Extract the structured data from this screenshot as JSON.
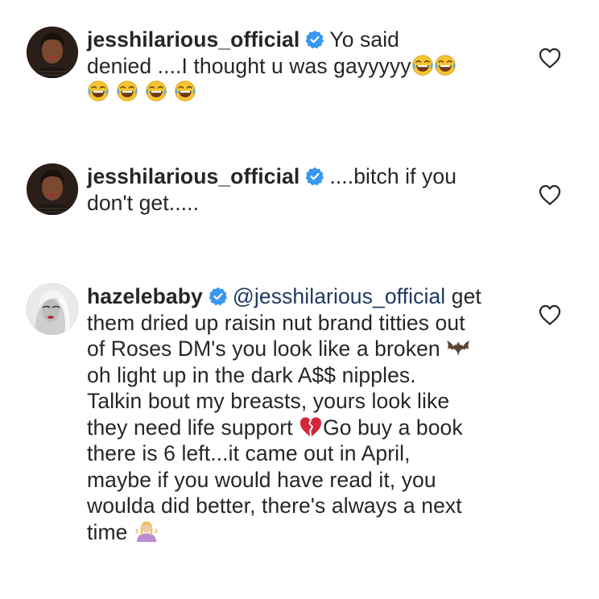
{
  "comments": [
    {
      "username": "jesshilarious_official",
      "line1": "Yo said",
      "line2": "denied ....I thought u was gayyyyy",
      "verified": true
    },
    {
      "username": "jesshilarious_official",
      "line1": "....bitch if you",
      "line2": "don't get.....",
      "verified": true
    },
    {
      "username": "hazelebaby",
      "mention": "@jesshilarious_official",
      "line1_end": "get",
      "lines": [
        "them dried up raisin nut brand titties out",
        "of Roses DM's you look like a broken",
        "oh light up in the dark A$$ nipples.",
        "Talkin bout my breasts, yours look like",
        "they need life support",
        "Go buy a book",
        "there is 6 left...it came out in April,",
        "maybe if you would have read it, you",
        "woulda did better, there's always a next",
        "time"
      ],
      "verified": true
    }
  ],
  "icons": {
    "verified": "verified-badge-icon",
    "like": "heart-outline-icon",
    "emoji_laugh": "face-with-tears-of-joy-emoji",
    "emoji_bat": "bat-emoji",
    "emoji_heart": "broken-heart-emoji",
    "emoji_shrug": "person-shrugging-emoji"
  },
  "colors": {
    "verified_blue": "#3897f0",
    "mention": "#1f3a64",
    "text": "#262626"
  }
}
